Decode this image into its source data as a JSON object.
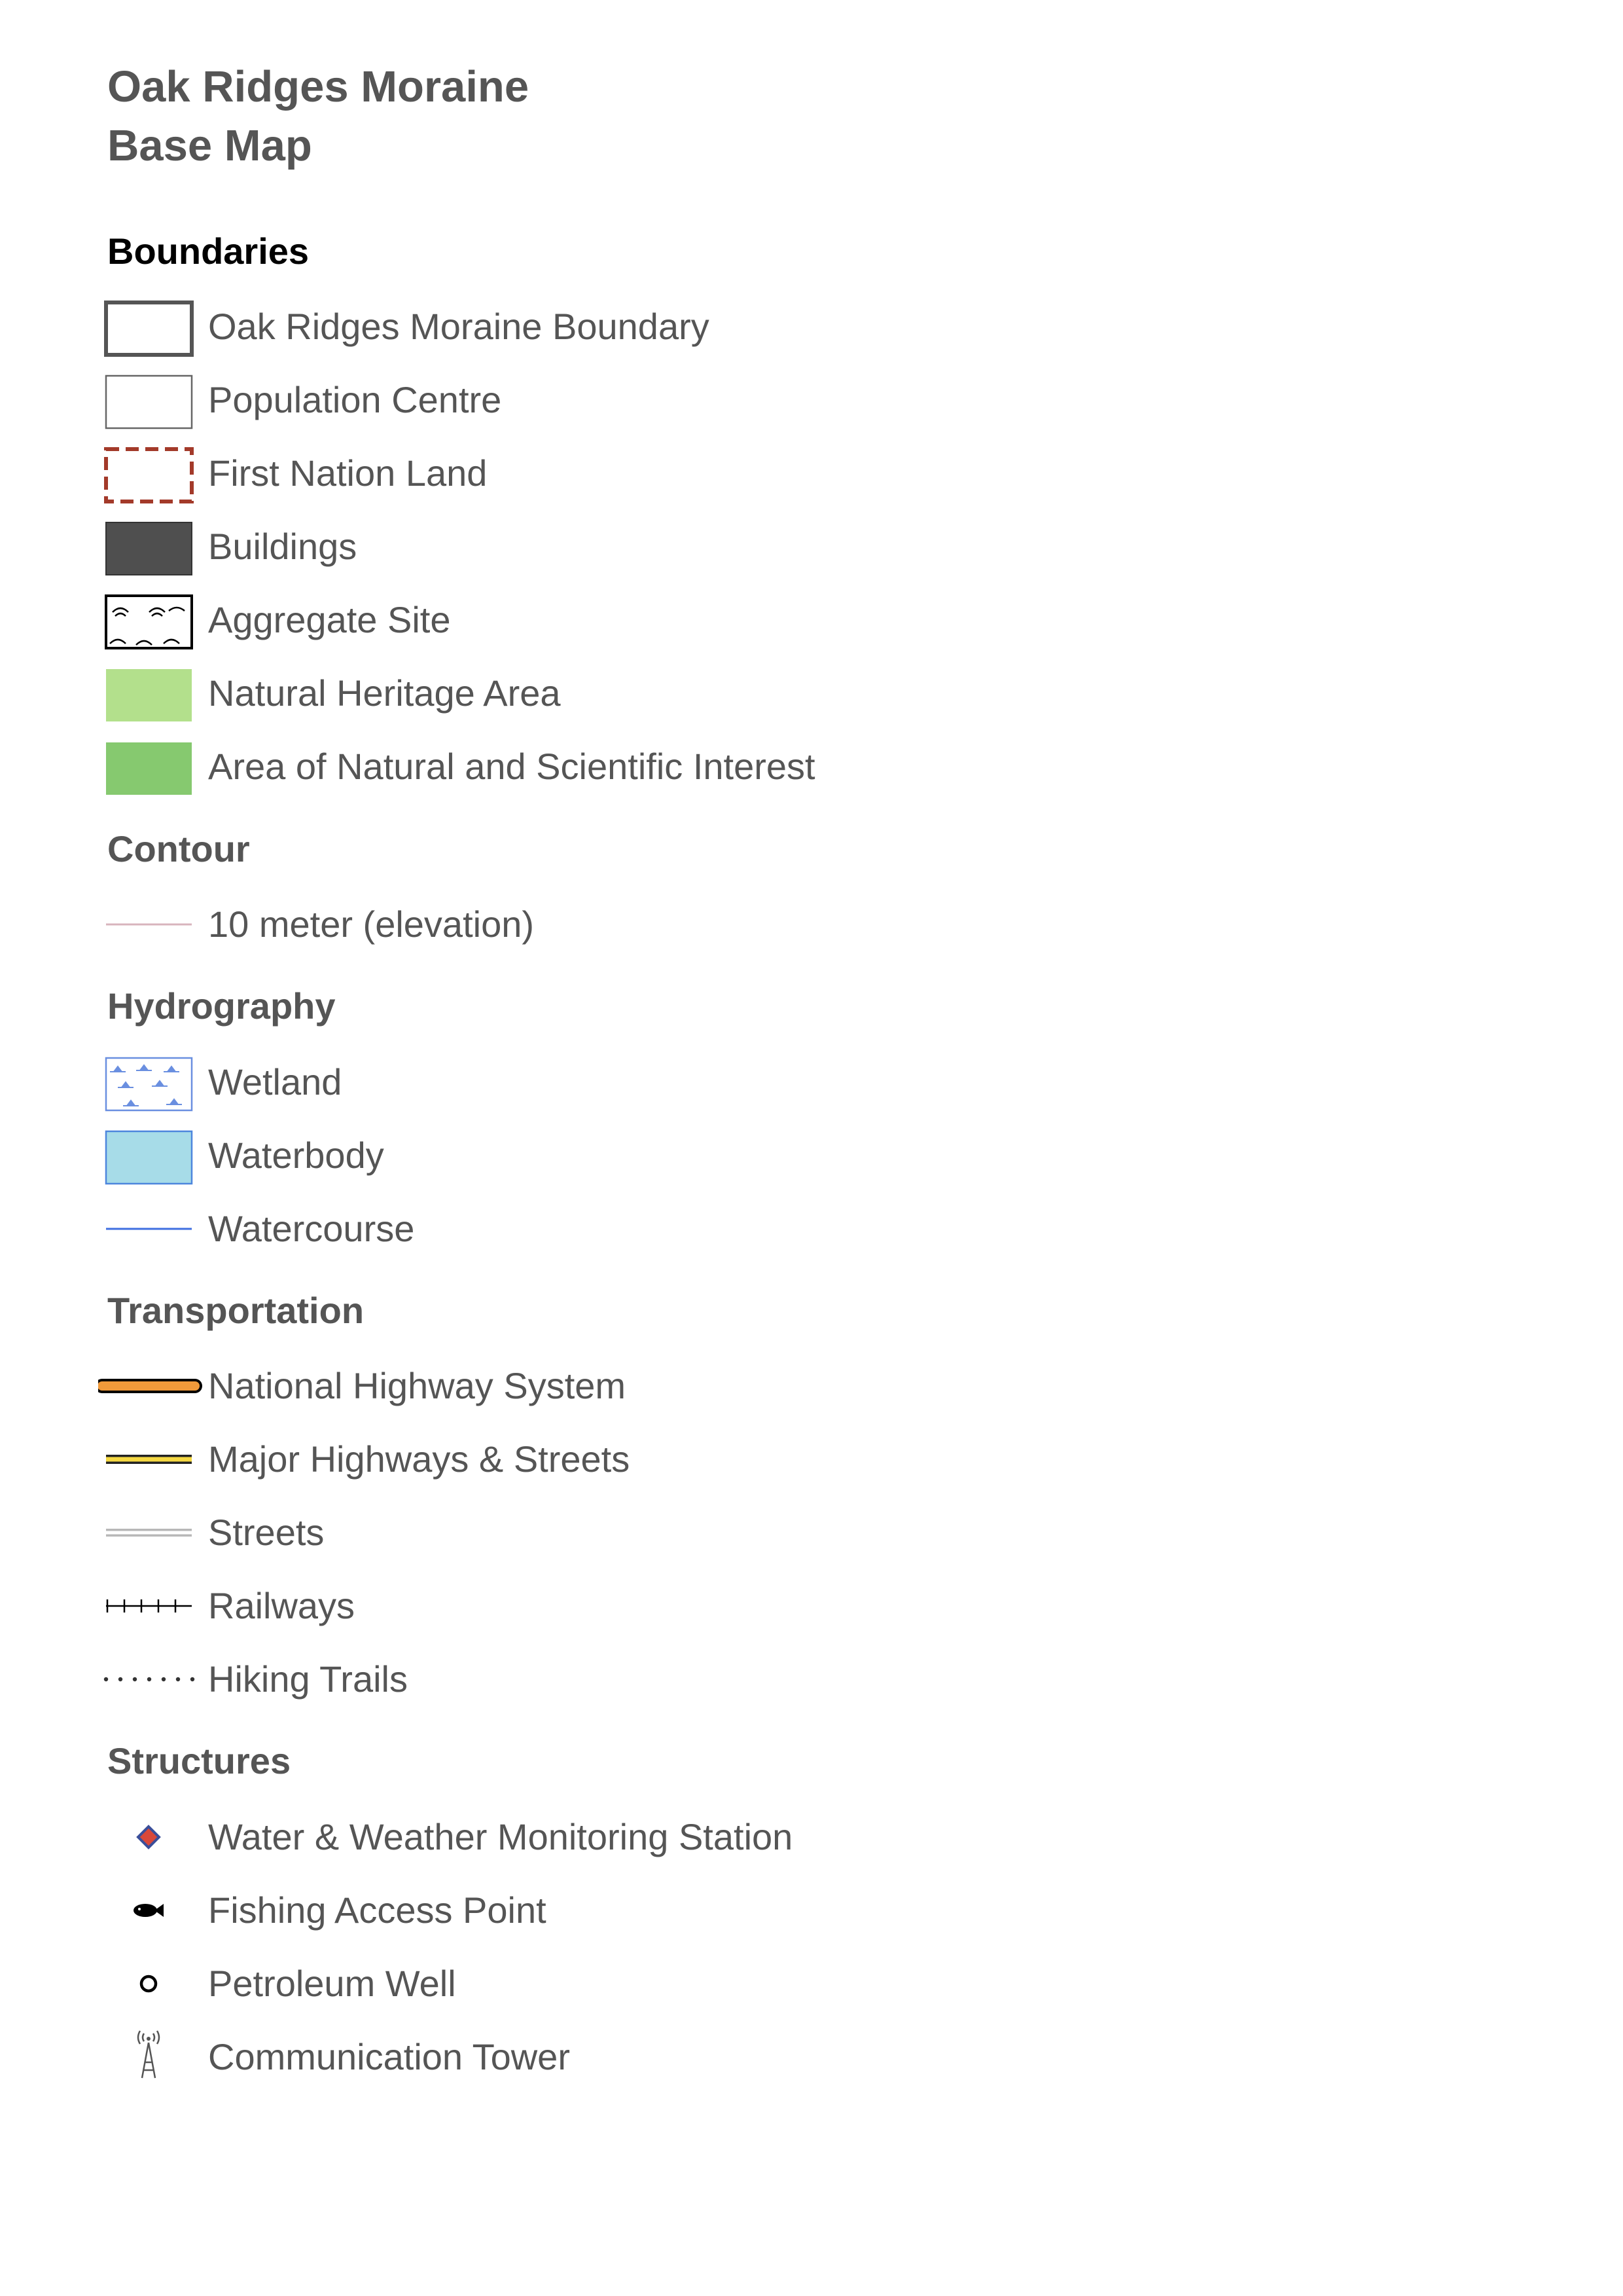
{
  "title": {
    "line1": "Oak Ridges Moraine",
    "line2": "Base Map"
  },
  "sections": {
    "boundaries": {
      "title": "Boundaries",
      "items": [
        {
          "label": "Oak Ridges Moraine Boundary",
          "symbol": "outline-box-heavy",
          "color": "#555555"
        },
        {
          "label": "Population Centre",
          "symbol": "outline-box-light",
          "color": "#666666"
        },
        {
          "label": "First Nation Land",
          "symbol": "dashed-box",
          "color": "#a33a2a"
        },
        {
          "label": "Buildings",
          "symbol": "filled-box",
          "color": "#4f4f4f"
        },
        {
          "label": "Aggregate Site",
          "symbol": "pattern-box",
          "color": "#000000"
        },
        {
          "label": "Natural Heritage Area",
          "symbol": "filled-box",
          "color": "#b3e08c"
        },
        {
          "label": "Area of Natural and Scientific Interest",
          "symbol": "filled-box",
          "color": "#86c96f"
        }
      ]
    },
    "contour": {
      "title": "Contour",
      "items": [
        {
          "label": "10 meter (elevation)",
          "symbol": "thin-line",
          "color": "#d8b4bd"
        }
      ]
    },
    "hydrography": {
      "title": "Hydrography",
      "items": [
        {
          "label": "Wetland",
          "symbol": "marsh-box",
          "color": "#6a8fe0"
        },
        {
          "label": "Waterbody",
          "symbol": "filled-box",
          "color": "#a7dce8"
        },
        {
          "label": "Watercourse",
          "symbol": "thin-line",
          "color": "#3f6ee0"
        }
      ]
    },
    "transportation": {
      "title": "Transportation",
      "items": [
        {
          "label": "National Highway System",
          "symbol": "highway-line",
          "color": "#f19a3a"
        },
        {
          "label": "Major Highways & Streets",
          "symbol": "major-road-line",
          "color": "#f5d842"
        },
        {
          "label": "Streets",
          "symbol": "street-line",
          "color": "#b8b8b8"
        },
        {
          "label": "Railways",
          "symbol": "railway-line",
          "color": "#000000"
        },
        {
          "label": "Hiking Trails",
          "symbol": "dotted-line",
          "color": "#333333"
        }
      ]
    },
    "structures": {
      "title": "Structures",
      "items": [
        {
          "label": "Water & Weather Monitoring Station",
          "symbol": "diamond-icon",
          "color": "#d8483a"
        },
        {
          "label": "Fishing Access Point",
          "symbol": "fish-icon",
          "color": "#000000"
        },
        {
          "label": "Petroleum Well",
          "symbol": "circle-icon",
          "color": "#000000"
        },
        {
          "label": "Communication Tower",
          "symbol": "tower-icon",
          "color": "#555555"
        }
      ]
    }
  }
}
